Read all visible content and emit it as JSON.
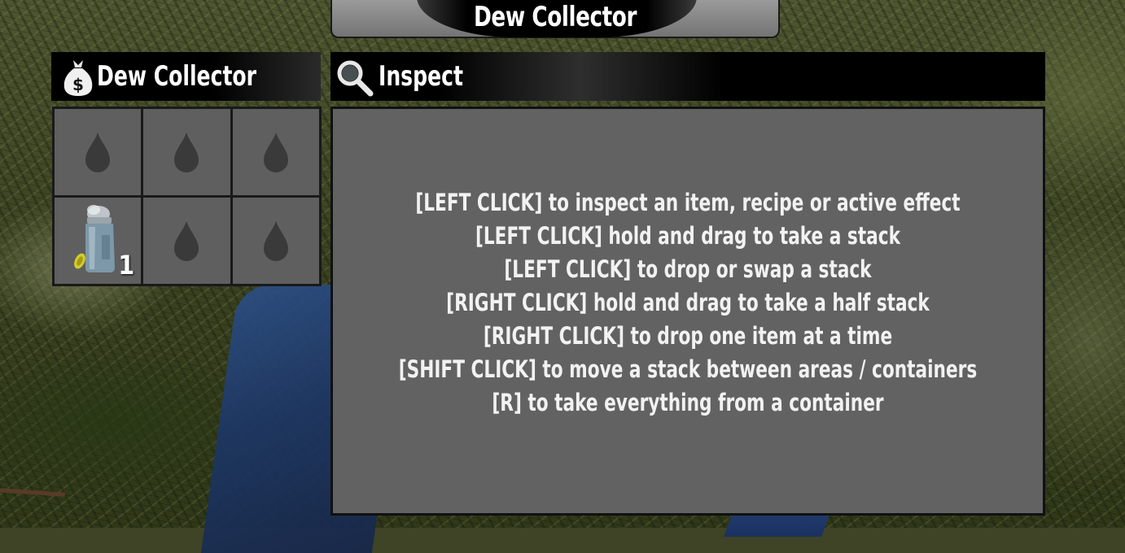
{
  "window": {
    "title": "Dew Collector"
  },
  "container": {
    "title": "Dew Collector",
    "icon": "money-bag-icon",
    "slots": [
      {
        "type": "empty",
        "icon": "water-drop-icon"
      },
      {
        "type": "empty",
        "icon": "water-drop-icon"
      },
      {
        "type": "empty",
        "icon": "water-drop-icon"
      },
      {
        "type": "item",
        "icon": "water-jar-icon",
        "count": "1"
      },
      {
        "type": "empty",
        "icon": "water-drop-icon"
      },
      {
        "type": "empty",
        "icon": "water-drop-icon"
      }
    ]
  },
  "inspect": {
    "title": "Inspect",
    "icon": "magnifier-icon",
    "help_lines": [
      "[LEFT CLICK] to inspect an item, recipe or active effect",
      "[LEFT CLICK] hold and drag to take a stack",
      "[LEFT CLICK] to drop or swap a stack",
      "[RIGHT CLICK] hold and drag to take a half stack",
      "[RIGHT CLICK] to drop one item at a time",
      "[SHIFT CLICK] to move a stack between areas / containers",
      "[R] to take everything from a container"
    ]
  }
}
